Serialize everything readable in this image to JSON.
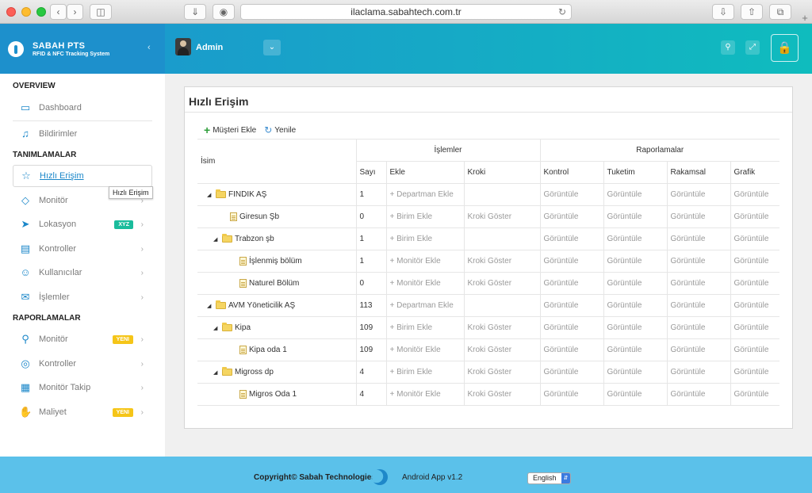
{
  "browser": {
    "url": "ilaclama.sabahtech.com.tr"
  },
  "brand": {
    "name": "SABAH PTS",
    "subtitle": "RFID & NFC Tracking System"
  },
  "header": {
    "user_name": "Admin"
  },
  "sidebar": {
    "sections": [
      "OVERVIEW",
      "TANIMLAMALAR",
      "RAPORLAMALAR"
    ],
    "overview": [
      {
        "label": "Dashboard",
        "icon": "monitor-icon"
      },
      {
        "label": "Bildirimler",
        "icon": "bell-icon"
      }
    ],
    "tanimlamalar": [
      {
        "label": "Hızlı Erişim",
        "icon": "star-icon"
      },
      {
        "label": "Monitör",
        "icon": "diamond-icon"
      },
      {
        "label": "Lokasyon",
        "icon": "location-arrow-icon",
        "badge": "XYZ"
      },
      {
        "label": "Kontroller",
        "icon": "wallet-icon"
      },
      {
        "label": "Kullanıcılar",
        "icon": "user-icon"
      },
      {
        "label": "İşlemler",
        "icon": "megaphone-icon"
      }
    ],
    "raporlamalar": [
      {
        "label": "Monitör",
        "icon": "pin-icon",
        "badge": "YENI"
      },
      {
        "label": "Kontroller",
        "icon": "target-icon"
      },
      {
        "label": "Monitör Takip",
        "icon": "calculator-icon"
      },
      {
        "label": "Maliyet",
        "icon": "hand-icon",
        "badge": "YENI"
      }
    ],
    "tooltip": "Hızlı Erişim"
  },
  "panel": {
    "title": "Hızlı Erişim",
    "add_customer": "Müşteri Ekle",
    "refresh": "Yenile"
  },
  "table": {
    "headers": {
      "name": "İsim",
      "operations_group": "İşlemler",
      "reports_group": "Raporlamalar",
      "count": "Sayı",
      "add": "Ekle",
      "sketch": "Kroki",
      "control": "Kontrol",
      "consumption": "Tuketim",
      "numeric": "Rakamsal",
      "graphic": "Grafik"
    },
    "rows": [
      {
        "name": "FINDIK AŞ",
        "count": "1",
        "add": "+ Departman Ekle",
        "sketch": "",
        "c1": "Görüntüle",
        "c2": "Görüntüle",
        "c3": "Görüntüle",
        "c4": "Görüntüle"
      },
      {
        "name": "Giresun Şb",
        "count": "0",
        "add": "+ Birim Ekle",
        "sketch": "Kroki Göster",
        "c1": "Görüntüle",
        "c2": "Görüntüle",
        "c3": "Görüntüle",
        "c4": "Görüntüle"
      },
      {
        "name": "Trabzon şb",
        "count": "1",
        "add": "+ Birim Ekle",
        "sketch": "",
        "c1": "Görüntüle",
        "c2": "Görüntüle",
        "c3": "Görüntüle",
        "c4": "Görüntüle"
      },
      {
        "name": "İşlenmiş bölüm",
        "count": "1",
        "add": "+ Monitör Ekle",
        "sketch": "Kroki Göster",
        "c1": "Görüntüle",
        "c2": "Görüntüle",
        "c3": "Görüntüle",
        "c4": "Görüntüle"
      },
      {
        "name": "Naturel Bölüm",
        "count": "0",
        "add": "+ Monitör Ekle",
        "sketch": "Kroki Göster",
        "c1": "Görüntüle",
        "c2": "Görüntüle",
        "c3": "Görüntüle",
        "c4": "Görüntüle"
      },
      {
        "name": "AVM Yöneticilik AŞ",
        "count": "113",
        "add": "+ Departman Ekle",
        "sketch": "",
        "c1": "Görüntüle",
        "c2": "Görüntüle",
        "c3": "Görüntüle",
        "c4": "Görüntüle"
      },
      {
        "name": "Kipa",
        "count": "109",
        "add": "+ Birim Ekle",
        "sketch": "Kroki Göster",
        "c1": "Görüntüle",
        "c2": "Görüntüle",
        "c3": "Görüntüle",
        "c4": "Görüntüle"
      },
      {
        "name": "Kipa oda 1",
        "count": "109",
        "add": "+ Monitör Ekle",
        "sketch": "Kroki Göster",
        "c1": "Görüntüle",
        "c2": "Görüntüle",
        "c3": "Görüntüle",
        "c4": "Görüntüle"
      },
      {
        "name": "Migross dp",
        "count": "4",
        "add": "+ Birim Ekle",
        "sketch": "Kroki Göster",
        "c1": "Görüntüle",
        "c2": "Görüntüle",
        "c3": "Görüntüle",
        "c4": "Görüntüle"
      },
      {
        "name": "Migros Oda 1",
        "count": "4",
        "add": "+ Monitör Ekle",
        "sketch": "Kroki Göster",
        "c1": "Görüntüle",
        "c2": "Görüntüle",
        "c3": "Görüntüle",
        "c4": "Görüntüle"
      }
    ]
  },
  "footer": {
    "copyright": "Copyright© Sabah Technologies",
    "app_version": "Android App v1.2",
    "language": "English"
  },
  "colors": {
    "brand_blue": "#1d90cc",
    "accent_teal": "#0fbcbe",
    "footer_blue": "#5bc1ea",
    "badge_green": "#1abc9c",
    "badge_yellow": "#f5c518"
  }
}
